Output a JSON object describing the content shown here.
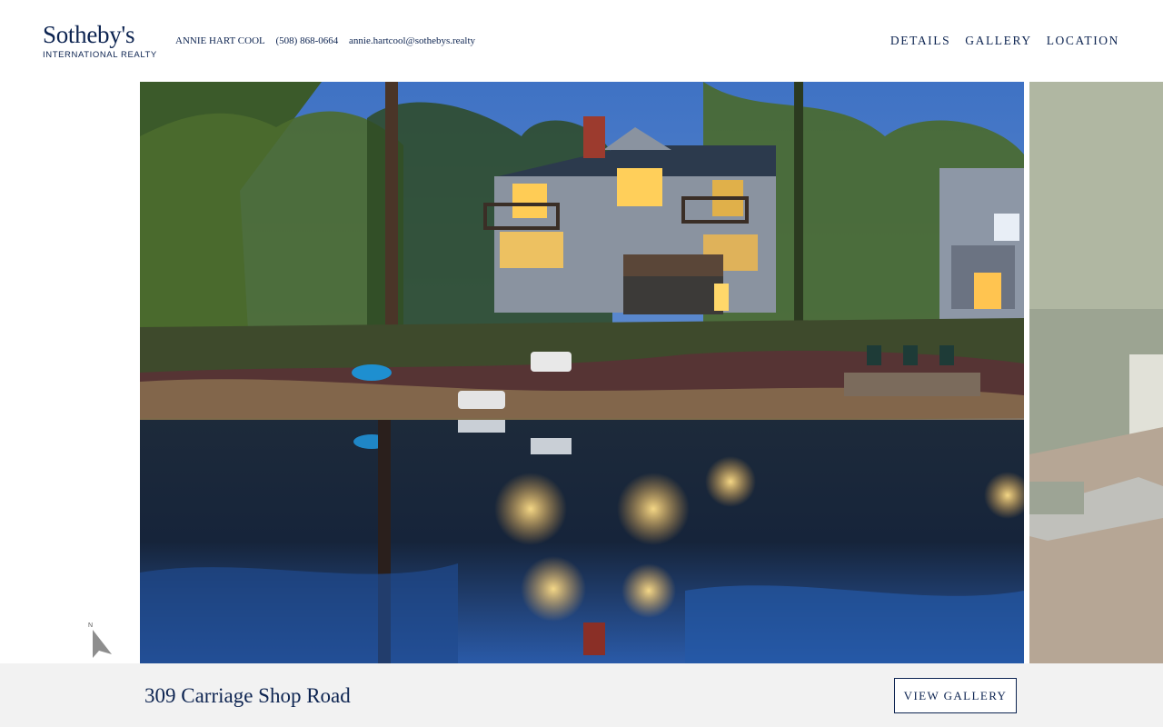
{
  "brand": {
    "name": "Sotheby's",
    "subtitle": "INTERNATIONAL REALTY"
  },
  "agent": {
    "name": "ANNIE HART COOL",
    "phone": "(508) 868-0664",
    "email": "annie.hartcool@sothebys.realty"
  },
  "nav": {
    "items": [
      "DETAILS",
      "GALLERY",
      "LOCATION"
    ]
  },
  "listing": {
    "address": "309 Carriage Shop Road",
    "view_gallery_label": "VIEW GALLERY"
  },
  "icons": {
    "cursor": "pointer-arrow-icon",
    "cursor_label": "N"
  },
  "colors": {
    "brand_navy": "#0d2451",
    "footer_bg": "#f2f2f2"
  }
}
